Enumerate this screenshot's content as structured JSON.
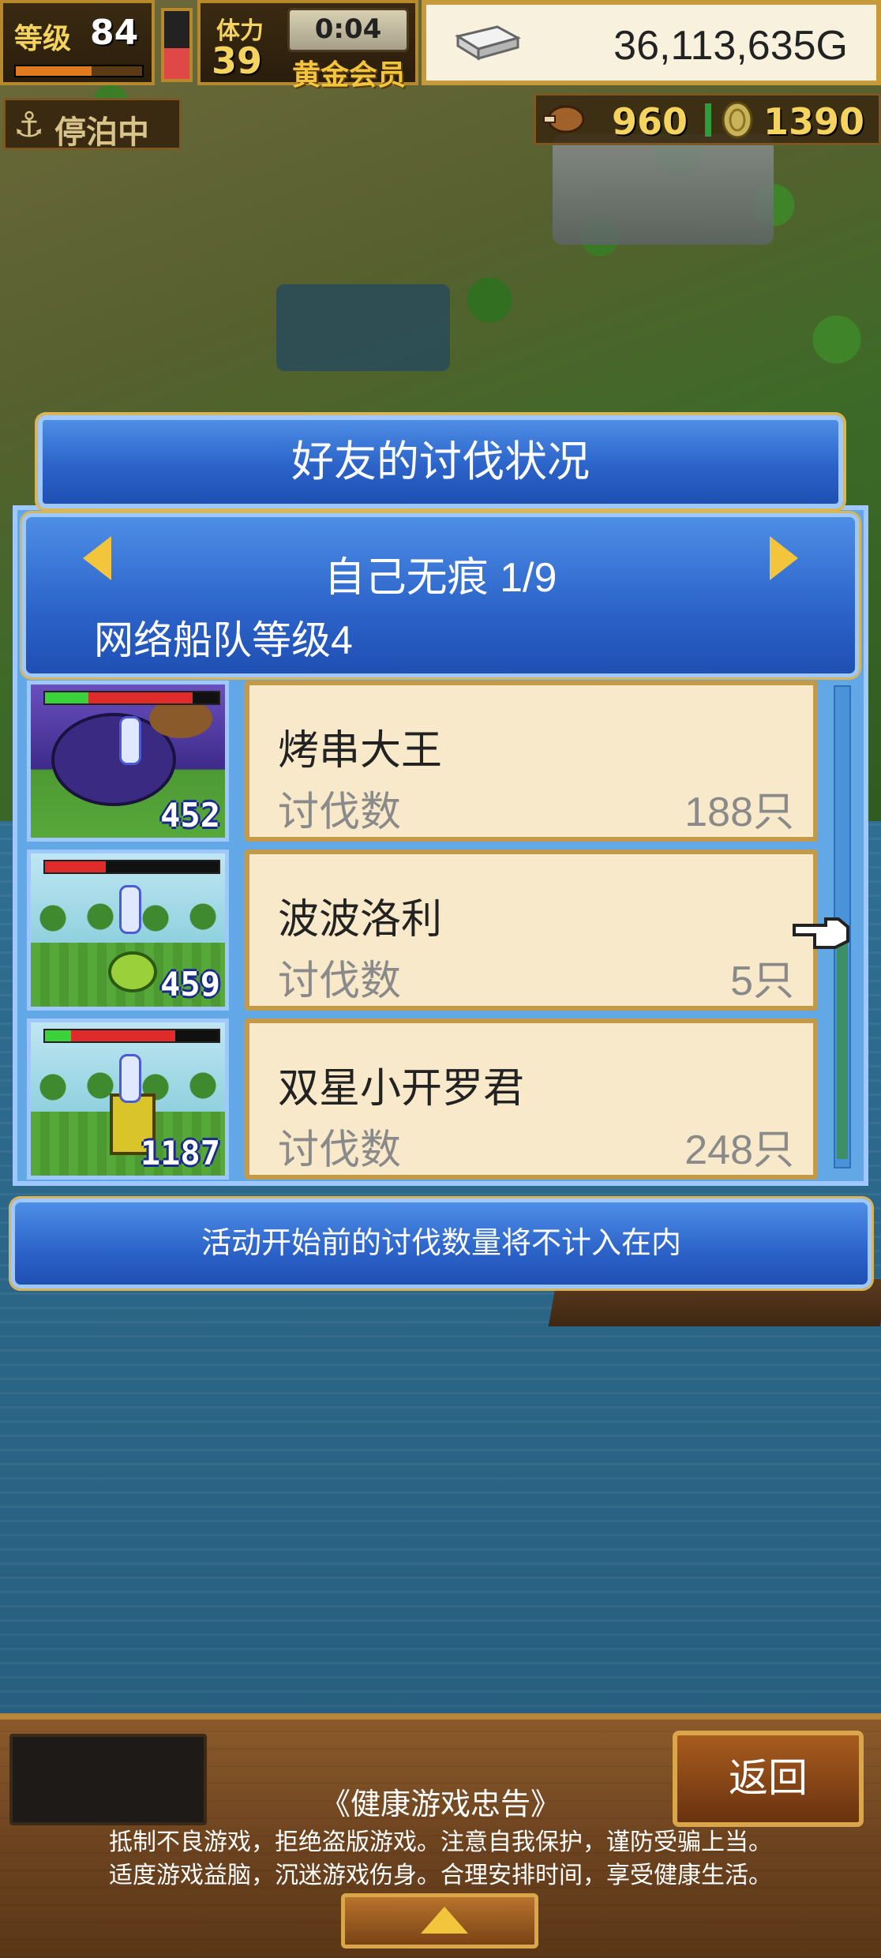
{
  "hud": {
    "level_label": "等级",
    "level_value": "84",
    "exp_progress": 0.6,
    "stamina_gauge_level": 0.45,
    "stamina_label": "体力",
    "stamina_value": "39",
    "timer": "0:04",
    "member_label": "黄金会员",
    "gold_value": "36,113,635G",
    "docked_label": "停泊中",
    "food_value": "960",
    "coin_value": "1390"
  },
  "dialog": {
    "title": "好友的讨伐状况",
    "friend_name": "自己无痕 1/9",
    "fleet_level": "网络船队等级4",
    "notice": "活动开始前的讨伐数量将不计入在内"
  },
  "rows": [
    {
      "name": "烤串大王",
      "kill_label": "讨伐数",
      "kill_value": "188只",
      "hp": "452",
      "hp_green": 0.25,
      "hp_red": 0.6
    },
    {
      "name": "波波洛利",
      "kill_label": "讨伐数",
      "kill_value": "5只",
      "hp": "459",
      "hp_green": 0.0,
      "hp_red": 0.35
    },
    {
      "name": "双星小开罗君",
      "kill_label": "讨伐数",
      "kill_value": "248只",
      "hp": "1187",
      "hp_green": 0.15,
      "hp_red": 0.6
    }
  ],
  "footer": {
    "back_label": "返回",
    "health_title": "《健康游戏忠告》",
    "health_line1": "抵制不良游戏，拒绝盗版游戏。注意自我保护，谨防受骗上当。",
    "health_line2": "适度游戏益脑，沉迷游戏伤身。合理安排时间，享受健康生活。"
  },
  "colors": {
    "panel_blue": "#2c63c9",
    "card_cream": "#f7e9c9",
    "gold_accent": "#f2c53d",
    "wood": "#6e4420"
  }
}
